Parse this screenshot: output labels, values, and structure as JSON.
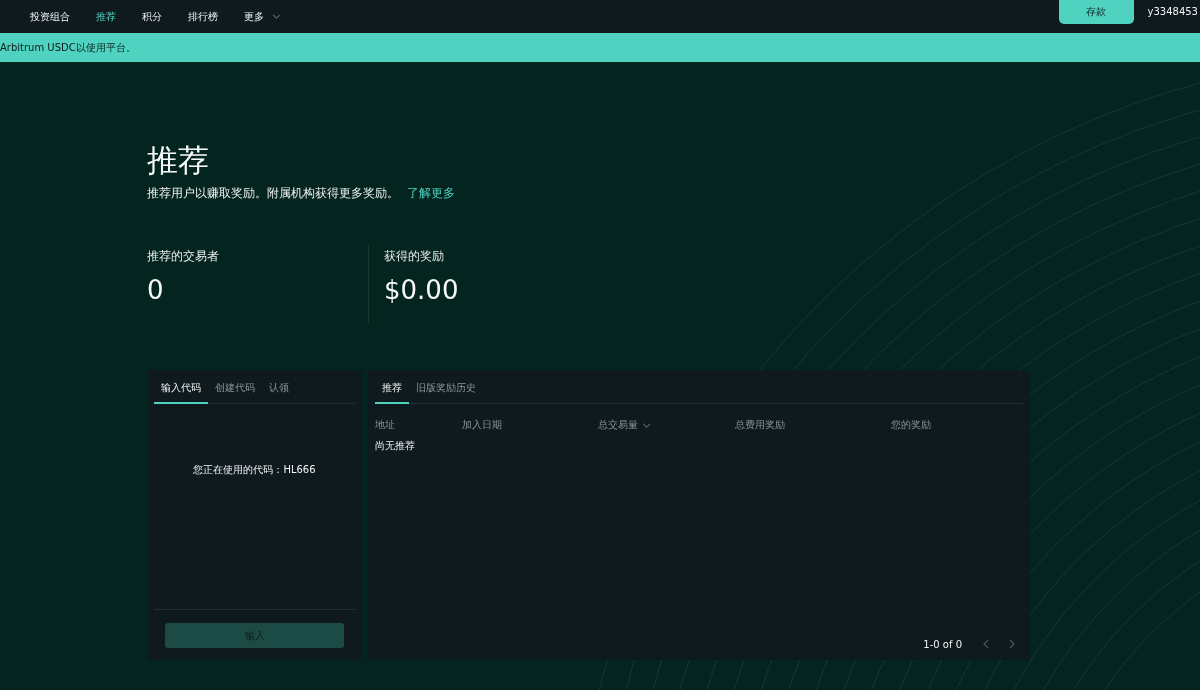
{
  "nav": {
    "items": [
      {
        "label": "投资组合",
        "selected": false,
        "kind": "link"
      },
      {
        "label": "推荐",
        "selected": true,
        "kind": "link"
      },
      {
        "label": "积分",
        "selected": false,
        "kind": "link"
      },
      {
        "label": "排行榜",
        "selected": false,
        "kind": "link"
      },
      {
        "label": "更多",
        "selected": false,
        "kind": "menu"
      }
    ],
    "deposit_button": "存款",
    "account": "y3348453"
  },
  "banner": {
    "text": "Arbitrum USDC以使用平台。"
  },
  "header": {
    "title": "推荐",
    "subtitle": "推荐用户以赚取奖励。附属机构获得更多奖励。",
    "link": "了解更多"
  },
  "stats": [
    {
      "label": "推荐的交易者",
      "value": "0"
    },
    {
      "label": "获得的奖励",
      "value": "$0.00"
    }
  ],
  "code_panel": {
    "tabs": [
      {
        "label": "输入代码",
        "selected": true
      },
      {
        "label": "创建代码",
        "selected": false
      },
      {
        "label": "认领",
        "selected": false
      }
    ],
    "message": "您正在使用的代码：HL666",
    "button": {
      "label": "输入",
      "disabled": true
    }
  },
  "referrals_panel": {
    "tabs": [
      {
        "label": "推荐",
        "selected": true
      },
      {
        "label": "旧版奖励历史",
        "selected": false
      }
    ],
    "columns": [
      {
        "label": "地址",
        "sortable": false
      },
      {
        "label": "加入日期",
        "sortable": false
      },
      {
        "label": "总交易量",
        "sortable": true
      },
      {
        "label": "总费用奖励",
        "sortable": false
      },
      {
        "label": "您的奖励",
        "sortable": false
      }
    ],
    "empty_text": "尚无推荐",
    "pagination": {
      "range": "1-0 of 0",
      "prev_disabled": true,
      "next_disabled": true
    }
  }
}
